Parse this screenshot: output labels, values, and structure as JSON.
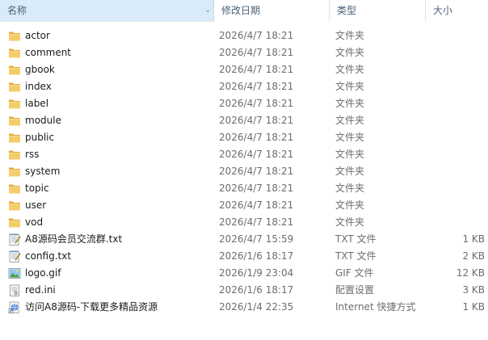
{
  "columns": {
    "name": "名称",
    "date": "修改日期",
    "type": "类型",
    "size": "大小"
  },
  "files": [
    {
      "name": "actor",
      "date": "2026/4/7 18:21",
      "type": "文件夹",
      "size": "",
      "icon": "folder-icon"
    },
    {
      "name": "comment",
      "date": "2026/4/7 18:21",
      "type": "文件夹",
      "size": "",
      "icon": "folder-icon"
    },
    {
      "name": "gbook",
      "date": "2026/4/7 18:21",
      "type": "文件夹",
      "size": "",
      "icon": "folder-icon"
    },
    {
      "name": "index",
      "date": "2026/4/7 18:21",
      "type": "文件夹",
      "size": "",
      "icon": "folder-icon"
    },
    {
      "name": "label",
      "date": "2026/4/7 18:21",
      "type": "文件夹",
      "size": "",
      "icon": "folder-icon"
    },
    {
      "name": "module",
      "date": "2026/4/7 18:21",
      "type": "文件夹",
      "size": "",
      "icon": "folder-icon"
    },
    {
      "name": "public",
      "date": "2026/4/7 18:21",
      "type": "文件夹",
      "size": "",
      "icon": "folder-icon"
    },
    {
      "name": "rss",
      "date": "2026/4/7 18:21",
      "type": "文件夹",
      "size": "",
      "icon": "folder-icon"
    },
    {
      "name": "system",
      "date": "2026/4/7 18:21",
      "type": "文件夹",
      "size": "",
      "icon": "folder-icon"
    },
    {
      "name": "topic",
      "date": "2026/4/7 18:21",
      "type": "文件夹",
      "size": "",
      "icon": "folder-icon"
    },
    {
      "name": "user",
      "date": "2026/4/7 18:21",
      "type": "文件夹",
      "size": "",
      "icon": "folder-icon"
    },
    {
      "name": "vod",
      "date": "2026/4/7 18:21",
      "type": "文件夹",
      "size": "",
      "icon": "folder-icon"
    },
    {
      "name": "A8源码会员交流群.txt",
      "date": "2026/4/7 15:59",
      "type": "TXT 文件",
      "size": "1 KB",
      "icon": "text-file-icon"
    },
    {
      "name": "config.txt",
      "date": "2026/1/6 18:17",
      "type": "TXT 文件",
      "size": "2 KB",
      "icon": "text-file-icon"
    },
    {
      "name": "logo.gif",
      "date": "2026/1/9 23:04",
      "type": "GIF 文件",
      "size": "12 KB",
      "icon": "image-file-icon"
    },
    {
      "name": "red.ini",
      "date": "2026/1/6 18:17",
      "type": "配置设置",
      "size": "3 KB",
      "icon": "settings-file-icon"
    },
    {
      "name": "访问A8源码-下载更多精品资源",
      "date": "2026/1/4 22:35",
      "type": "Internet 快捷方式",
      "size": "1 KB",
      "icon": "internet-shortcut-icon"
    }
  ],
  "colors": {
    "header_selected_bg": "#d9ebf9",
    "header_text": "#4c607a",
    "folder": "#e8b84a",
    "secondary_text": "#6d6d6d"
  }
}
